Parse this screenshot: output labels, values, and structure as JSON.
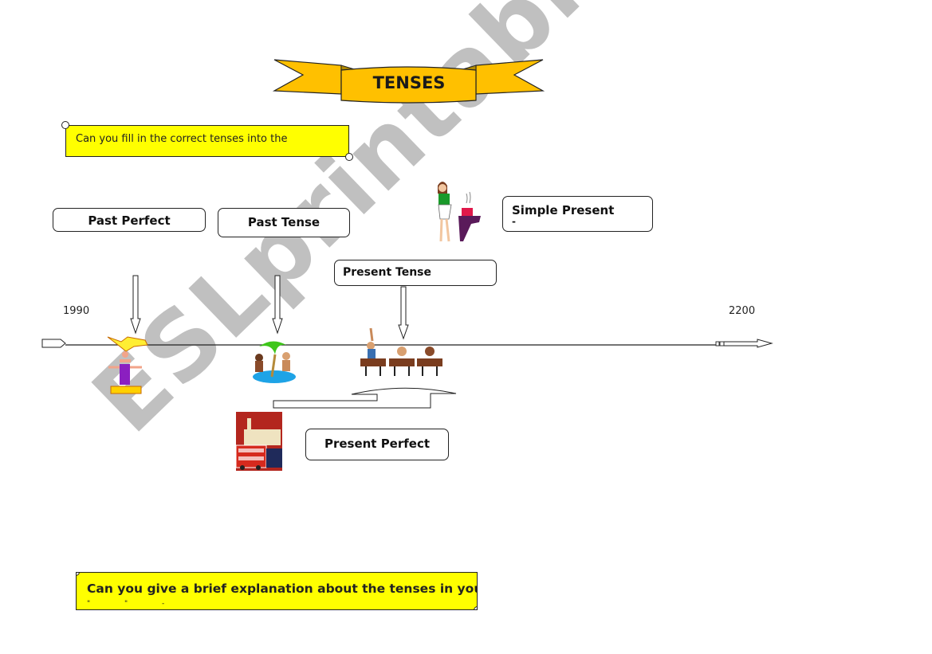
{
  "banner": {
    "title": "TENSES",
    "color": "#ffc000"
  },
  "instructions": {
    "top": "Can you fill in the correct tenses into the",
    "bottom": "Can you give a brief explanation about the tenses in your",
    "bottom_cutoff": "\" \" -",
    "color": "#ffff00"
  },
  "timeline": {
    "start_year": "1990",
    "end_year": "2200"
  },
  "tense_boxes": {
    "past_perfect": "Past Perfect",
    "past_tense": "Past Tense",
    "present_tense": "Present Tense",
    "simple_present": "Simple Present",
    "simple_present_sub": "-",
    "present_perfect": "Present Perfect"
  },
  "illustrations": {
    "past_perfect": "acrobats-clipart",
    "past_tense": "island-vacation-clipart",
    "present_tense": "classroom-students-clipart",
    "simple_present": "woman-cooking-clipart",
    "present_perfect": "london-bus-clipart"
  },
  "watermark": "ESLprintables.com"
}
